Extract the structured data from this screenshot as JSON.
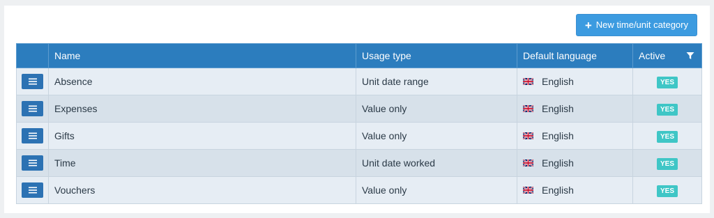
{
  "toolbar": {
    "new_button_label": "New time/unit category"
  },
  "table": {
    "headers": {
      "name": "Name",
      "usage_type": "Usage type",
      "default_language": "Default language",
      "active": "Active"
    },
    "rows": [
      {
        "name": "Absence",
        "usage_type": "Unit date range",
        "language": "English",
        "active": "YES"
      },
      {
        "name": "Expenses",
        "usage_type": "Value only",
        "language": "English",
        "active": "YES"
      },
      {
        "name": "Gifts",
        "usage_type": "Value only",
        "language": "English",
        "active": "YES"
      },
      {
        "name": "Time",
        "usage_type": "Unit date worked",
        "language": "English",
        "active": "YES"
      },
      {
        "name": "Vouchers",
        "usage_type": "Value only",
        "language": "English",
        "active": "YES"
      }
    ]
  },
  "icons": {
    "new_button": "plus-icon",
    "row_menu": "hamburger-icon",
    "flag": "uk-flag-icon",
    "filter": "filter-icon"
  },
  "colors": {
    "header_bg": "#2c7dbe",
    "primary_button": "#3c9be0",
    "row_menu_button": "#2c72b3",
    "active_badge": "#3fc6c6",
    "row_odd": "#e6edf4",
    "row_even": "#d7e1ea"
  }
}
